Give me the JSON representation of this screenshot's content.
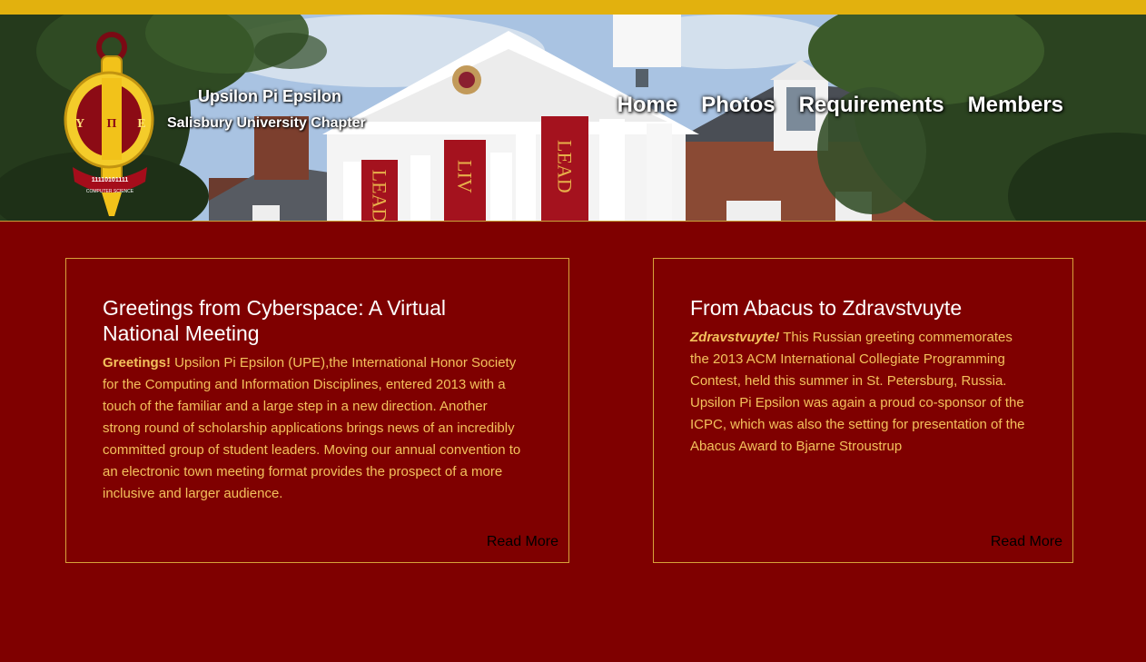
{
  "header": {
    "org_name": "Upsilon Pi Epsilon",
    "chapter_name": "Salisbury University Chapter",
    "logo": {
      "greek_letters": [
        "Υ",
        "Π",
        "Ε"
      ],
      "binary": "11110101111",
      "ribbon_text": "COMPUTER SCIENCE"
    },
    "banners": [
      "LEAD",
      "LIV",
      "LEAD"
    ]
  },
  "nav": {
    "items": [
      {
        "label": "Home"
      },
      {
        "label": "Photos"
      },
      {
        "label": "Requirements"
      },
      {
        "label": "Members"
      }
    ]
  },
  "articles": [
    {
      "title": "Greetings from Cyberspace: A Virtual National Meeting",
      "lead": "Greetings!",
      "body": " Upsilon Pi Epsilon (UPE),the International Honor Society for the Computing and Information Disciplines, entered 2013 with a touch of the familiar and a large step in a new direction. Another strong round of scholarship applications brings news of an incredibly committed group of student leaders. Moving our annual convention to an electronic town meeting format provides the prospect of a more inclusive and larger audience.",
      "read_more": "Read More"
    },
    {
      "title": "From Abacus to Zdravstvuyte",
      "lead": "Zdravstvuyte!",
      "body": " This Russian greeting commemorates the 2013 ACM International Collegiate Programming Contest, held this summer in St. Petersburg, Russia. Upsilon Pi Epsilon was again a proud co-sponsor of the ICPC, which was also the setting for presentation of the Abacus Award to Bjarne Stroustrup",
      "read_more": "Read More"
    }
  ],
  "colors": {
    "background": "#7f0000",
    "top_bar": "#e2b10e",
    "body_text": "#f3c15c",
    "card_border": "#d8a23a"
  }
}
